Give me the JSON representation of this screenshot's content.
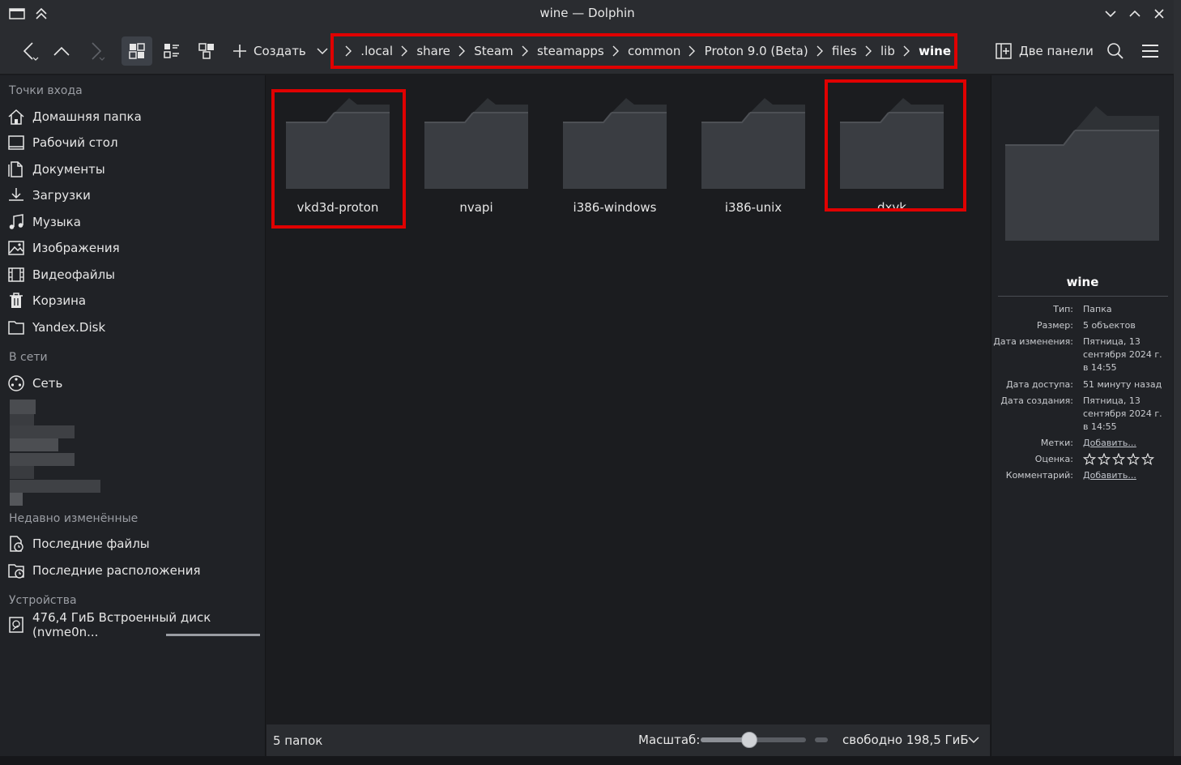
{
  "window": {
    "title": "wine — Dolphin"
  },
  "toolbar": {
    "create_label": "Создать",
    "dual_panel_label": "Две панели"
  },
  "breadcrumbs": [
    ".local",
    "share",
    "Steam",
    "steamapps",
    "common",
    "Proton 9.0 (Beta)",
    "files",
    "lib",
    "wine"
  ],
  "sidebar": {
    "sections": [
      {
        "heading": "Точки входа",
        "items": [
          "Домашняя папка",
          "Рабочий стол",
          "Документы",
          "Загрузки",
          "Музыка",
          "Изображения",
          "Видеофайлы",
          "Корзина",
          "Yandex.Disk"
        ]
      },
      {
        "heading": "В сети",
        "items": [
          "Сеть"
        ]
      },
      {
        "heading": "Недавно изменённые",
        "items": [
          "Последние файлы",
          "Последние расположения"
        ]
      },
      {
        "heading": "Устройства",
        "items": [
          "476,4 ГиБ Встроенный диск (nvme0n..."
        ]
      }
    ],
    "icons": [
      "home-icon",
      "desktop-icon",
      "document-icon",
      "download-icon",
      "music-icon",
      "image-icon",
      "video-icon",
      "trash-icon",
      "folder-icon",
      "network-icon",
      "recent-files-icon",
      "recent-locations-icon",
      "drive-icon"
    ]
  },
  "folders": [
    "vkd3d-proton",
    "nvapi",
    "i386-windows",
    "i386-unix",
    "dxvk"
  ],
  "status": {
    "count_text": "5 папок",
    "zoom_label": "Масштаб:",
    "zoom_level": 0.45,
    "free_space": "свободно 198,5 ГиБ"
  },
  "info_panel": {
    "title": "wine",
    "rows": [
      {
        "key": "Тип:",
        "value": "Папка"
      },
      {
        "key": "Размер:",
        "value": "5 объектов"
      },
      {
        "key": "Дата изменения:",
        "value": "Пятница, 13 сентября 2024 г. в 14:55"
      },
      {
        "key": "Дата доступа:",
        "value": "51 минуту назад"
      },
      {
        "key": "Дата создания:",
        "value": "Пятница, 13 сентября 2024 г. в 14:55"
      },
      {
        "key": "Метки:",
        "value": "Добавить..."
      },
      {
        "key": "Оценка:",
        "value": ""
      },
      {
        "key": "Комментарий:",
        "value": "Добавить..."
      }
    ],
    "rating": 0
  },
  "colors": {
    "highlight": "#e00000",
    "background": "#1b1c1f",
    "panel": "#202226",
    "toolbar": "#2a2c30"
  }
}
